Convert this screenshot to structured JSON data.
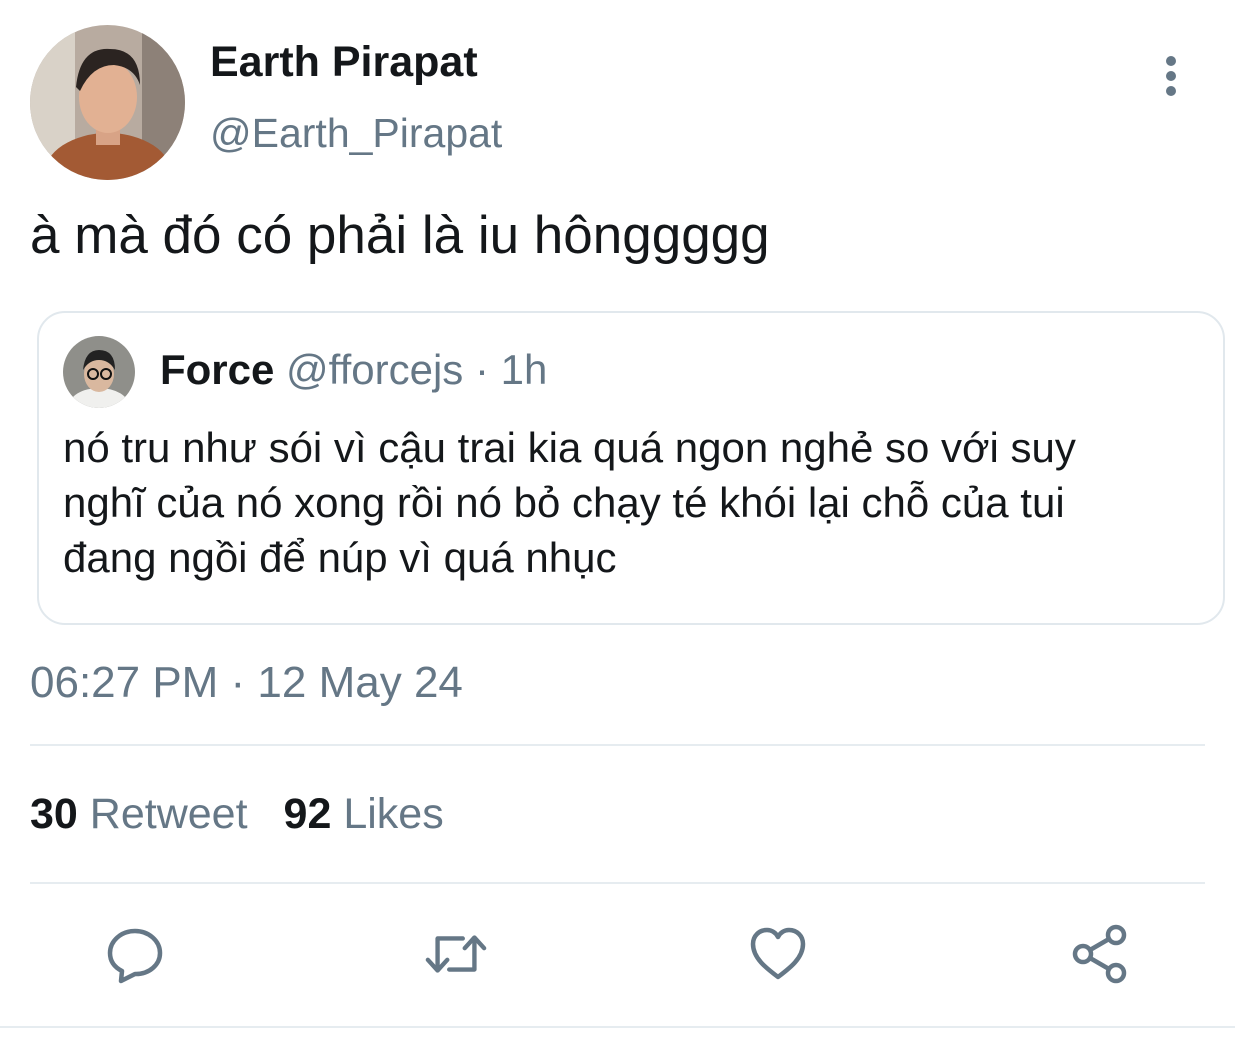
{
  "tweet": {
    "author": {
      "display_name": "Earth Pirapat",
      "handle": "@Earth_Pirapat"
    },
    "text": "à mà đó có phải là iu hônggggg",
    "quoted": {
      "author_name": "Force",
      "handle": "@fforcejs",
      "separator": " · ",
      "time_ago": "1h",
      "text": "nó tru như sói vì cậu trai kia quá ngon nghẻ so với suy\nnghĩ của nó xong rồi nó bỏ chạy té khói lại chỗ của tui\nđang ngồi để núp vì quá nhục"
    },
    "timestamp": "06:27 PM · 12 May 24",
    "stats": {
      "retweets": "30",
      "retweets_label": "Retweet",
      "likes": "92",
      "likes_label": "Likes"
    }
  },
  "icons": {
    "more": "more-vertical-icon",
    "reply": "reply-icon",
    "retweet": "retweet-icon",
    "like": "heart-icon",
    "share": "share-icon"
  },
  "colors": {
    "text_primary": "#14171a",
    "text_secondary": "#657786",
    "icon": "#657786",
    "border": "#e1e8ed"
  }
}
